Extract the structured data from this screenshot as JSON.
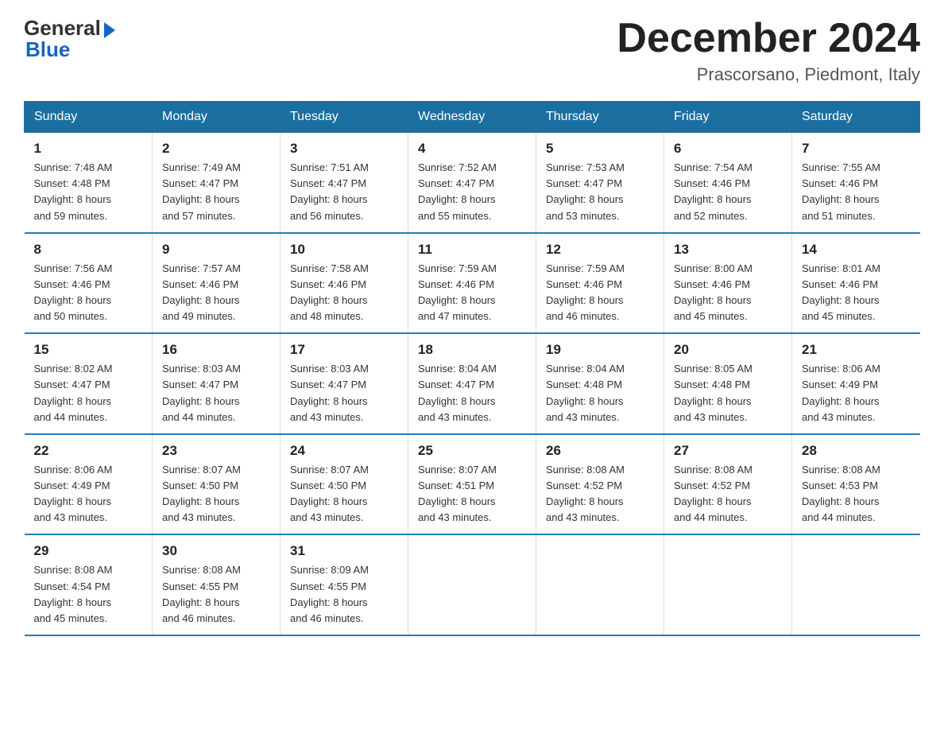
{
  "header": {
    "logo_general": "General",
    "logo_blue": "Blue",
    "title": "December 2024",
    "location": "Prascorsano, Piedmont, Italy"
  },
  "days_of_week": [
    "Sunday",
    "Monday",
    "Tuesday",
    "Wednesday",
    "Thursday",
    "Friday",
    "Saturday"
  ],
  "weeks": [
    [
      {
        "day": "1",
        "sunrise": "7:48 AM",
        "sunset": "4:48 PM",
        "daylight": "8 hours and 59 minutes."
      },
      {
        "day": "2",
        "sunrise": "7:49 AM",
        "sunset": "4:47 PM",
        "daylight": "8 hours and 57 minutes."
      },
      {
        "day": "3",
        "sunrise": "7:51 AM",
        "sunset": "4:47 PM",
        "daylight": "8 hours and 56 minutes."
      },
      {
        "day": "4",
        "sunrise": "7:52 AM",
        "sunset": "4:47 PM",
        "daylight": "8 hours and 55 minutes."
      },
      {
        "day": "5",
        "sunrise": "7:53 AM",
        "sunset": "4:47 PM",
        "daylight": "8 hours and 53 minutes."
      },
      {
        "day": "6",
        "sunrise": "7:54 AM",
        "sunset": "4:46 PM",
        "daylight": "8 hours and 52 minutes."
      },
      {
        "day": "7",
        "sunrise": "7:55 AM",
        "sunset": "4:46 PM",
        "daylight": "8 hours and 51 minutes."
      }
    ],
    [
      {
        "day": "8",
        "sunrise": "7:56 AM",
        "sunset": "4:46 PM",
        "daylight": "8 hours and 50 minutes."
      },
      {
        "day": "9",
        "sunrise": "7:57 AM",
        "sunset": "4:46 PM",
        "daylight": "8 hours and 49 minutes."
      },
      {
        "day": "10",
        "sunrise": "7:58 AM",
        "sunset": "4:46 PM",
        "daylight": "8 hours and 48 minutes."
      },
      {
        "day": "11",
        "sunrise": "7:59 AM",
        "sunset": "4:46 PM",
        "daylight": "8 hours and 47 minutes."
      },
      {
        "day": "12",
        "sunrise": "7:59 AM",
        "sunset": "4:46 PM",
        "daylight": "8 hours and 46 minutes."
      },
      {
        "day": "13",
        "sunrise": "8:00 AM",
        "sunset": "4:46 PM",
        "daylight": "8 hours and 45 minutes."
      },
      {
        "day": "14",
        "sunrise": "8:01 AM",
        "sunset": "4:46 PM",
        "daylight": "8 hours and 45 minutes."
      }
    ],
    [
      {
        "day": "15",
        "sunrise": "8:02 AM",
        "sunset": "4:47 PM",
        "daylight": "8 hours and 44 minutes."
      },
      {
        "day": "16",
        "sunrise": "8:03 AM",
        "sunset": "4:47 PM",
        "daylight": "8 hours and 44 minutes."
      },
      {
        "day": "17",
        "sunrise": "8:03 AM",
        "sunset": "4:47 PM",
        "daylight": "8 hours and 43 minutes."
      },
      {
        "day": "18",
        "sunrise": "8:04 AM",
        "sunset": "4:47 PM",
        "daylight": "8 hours and 43 minutes."
      },
      {
        "day": "19",
        "sunrise": "8:04 AM",
        "sunset": "4:48 PM",
        "daylight": "8 hours and 43 minutes."
      },
      {
        "day": "20",
        "sunrise": "8:05 AM",
        "sunset": "4:48 PM",
        "daylight": "8 hours and 43 minutes."
      },
      {
        "day": "21",
        "sunrise": "8:06 AM",
        "sunset": "4:49 PM",
        "daylight": "8 hours and 43 minutes."
      }
    ],
    [
      {
        "day": "22",
        "sunrise": "8:06 AM",
        "sunset": "4:49 PM",
        "daylight": "8 hours and 43 minutes."
      },
      {
        "day": "23",
        "sunrise": "8:07 AM",
        "sunset": "4:50 PM",
        "daylight": "8 hours and 43 minutes."
      },
      {
        "day": "24",
        "sunrise": "8:07 AM",
        "sunset": "4:50 PM",
        "daylight": "8 hours and 43 minutes."
      },
      {
        "day": "25",
        "sunrise": "8:07 AM",
        "sunset": "4:51 PM",
        "daylight": "8 hours and 43 minutes."
      },
      {
        "day": "26",
        "sunrise": "8:08 AM",
        "sunset": "4:52 PM",
        "daylight": "8 hours and 43 minutes."
      },
      {
        "day": "27",
        "sunrise": "8:08 AM",
        "sunset": "4:52 PM",
        "daylight": "8 hours and 44 minutes."
      },
      {
        "day": "28",
        "sunrise": "8:08 AM",
        "sunset": "4:53 PM",
        "daylight": "8 hours and 44 minutes."
      }
    ],
    [
      {
        "day": "29",
        "sunrise": "8:08 AM",
        "sunset": "4:54 PM",
        "daylight": "8 hours and 45 minutes."
      },
      {
        "day": "30",
        "sunrise": "8:08 AM",
        "sunset": "4:55 PM",
        "daylight": "8 hours and 46 minutes."
      },
      {
        "day": "31",
        "sunrise": "8:09 AM",
        "sunset": "4:55 PM",
        "daylight": "8 hours and 46 minutes."
      },
      null,
      null,
      null,
      null
    ]
  ],
  "labels": {
    "sunrise": "Sunrise:",
    "sunset": "Sunset:",
    "daylight": "Daylight:"
  }
}
